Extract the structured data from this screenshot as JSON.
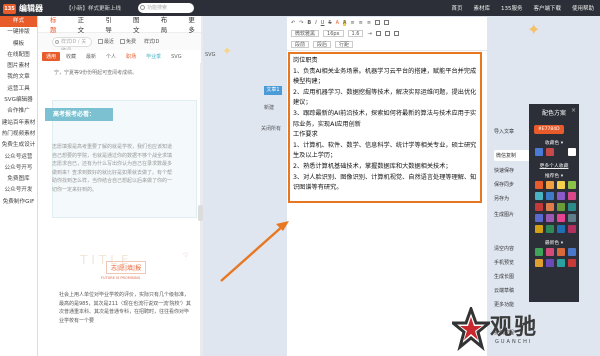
{
  "topbar": {
    "logo_box": "135",
    "logo_text": "编辑器",
    "notice": "【小新】样式更新上线",
    "search_placeholder": "功能搜索",
    "nav": [
      "首页",
      "素材库",
      "135服务",
      "客户端下载",
      "使用帮助"
    ]
  },
  "leftnav": [
    "样式",
    "一键排版",
    "模板",
    "在线配图",
    "图片素材",
    "我的文章",
    "运营工具",
    "SVG编辑器",
    "合作推广",
    "建站百年素材",
    "热门视频素材",
    "免费生成设计",
    "公众号运营",
    "公众号开写",
    "免费图库",
    "公众号开发",
    "免费制作GIF"
  ],
  "tabs": [
    "标题",
    "正文",
    "引导",
    "图文",
    "布局",
    "更多"
  ],
  "filter": {
    "search_placeholder": "样式ID / 关键词",
    "latest": "最近",
    "free": "免费",
    "style_id": "样式ID"
  },
  "chips": [
    "通用",
    "收藏",
    "最新",
    "个人",
    "职场",
    "毕业季",
    "SVG"
  ],
  "panel": {
    "top_text": "宁，宁夏等9份份明起可查阅考成绩。",
    "badge": "高考报考必看：",
    "card_text": "志愿填报是高考重要了解的就是学校，我们也应该知道自己想要的学院，也就是通过你的数据不够个战全求填志愿求自已，还有为什么写出你认为自己在录求数最多做到来？查求到数好的就比好是如果就去做了。有个帮助你找到怎么样，当你结合自己想起以后来做了你的一切你一定来好到的。",
    "faint_title": "TITLE",
    "red_title": "志|愿|填|报",
    "red_sub": "FUTURE IS PROMISING",
    "para": "社会上用人单位对毕业学校的评价，实际只有几个级标准，最高的是985，其次是211（现在也流行说双一流'院校'）其次普通重本科、其次是普通专科，在招聘时，往往看你对毕业学校有一个要"
  },
  "editor": {
    "svg_tag": "SVG",
    "left_tag": "文章1",
    "left_tools": [
      "新建",
      "关闭所有"
    ],
    "toolbar_row1": [
      "↶",
      "↷",
      "B",
      "I",
      "U",
      "S",
      "A",
      "A",
      "≡",
      "≡",
      "≡"
    ],
    "toolbar_row2": [
      "微软雅黑",
      "16px",
      "1.6",
      "⇥"
    ],
    "toolbar_row3": [
      "段前",
      "段后",
      "行距"
    ],
    "content": [
      "岗位职责",
      "1、负责AI相关业务场景。机器学习云平台的搭建，赋能平台并完成模型构建；",
      "2、应用机器学习、数据挖掘等技术，解决实际运维问题，提出优化建议；",
      "3、跟踪最新的AI前沿技术，探索如何将最新的算法与技术应用于实际业务，实现AI应用创新",
      "工作要求",
      "1、计算机、软件、数学、信息科学、统计学等相关专业，硕士研究生及以上学历；",
      "2、熟悉计算机基础技术，掌握数据库和大数据相关技术；",
      "3、对人脸识别、图像识别、计算机视觉、自然语言处理等理解、知识图谱等有研究。"
    ]
  },
  "right_buttons": [
    "导入文章",
    "微信复制",
    "快速保存",
    "保存同步",
    "另存为",
    "生成图片",
    "清空内容",
    "手机预览",
    "生成长图",
    "云端草稿",
    "更多功能",
    "投稿教程"
  ],
  "theme": {
    "title": "配色方案",
    "close": "×",
    "pill": "#E7784D",
    "label1": "收藏色 ▾",
    "label2": "更多个人收藏",
    "label3": "推荐色 ▾",
    "label4": "最新色 ▾",
    "colors_fav": [
      "#4a7bd6",
      "#c64a4a",
      "#2c2f37",
      "#ffffff"
    ],
    "colors_rec": [
      "#e85c2c",
      "#f0a040",
      "#f6d04a",
      "#8bc34a",
      "#4ab3c4",
      "#3f79c9",
      "#8a5ac8",
      "#d9488a",
      "#c23a3a",
      "#e07d4a",
      "#6b9c3a",
      "#2a8b8b",
      "#5a6acf",
      "#9b59b6",
      "#e84393",
      "#607d8b",
      "#d4a017",
      "#2e8b57",
      "#1f6fb5",
      "#b03060"
    ],
    "colors_new": [
      "#3fa35a",
      "#d44a7a",
      "#d86a3a",
      "#4a78c8",
      "#e0a030",
      "#6a4ab8",
      "#2aa0a0",
      "#c83a3a"
    ]
  },
  "watermark": {
    "text": "观驰",
    "sub": "GUANCHI"
  }
}
